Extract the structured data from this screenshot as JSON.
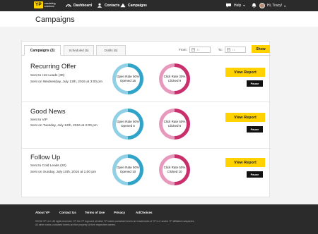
{
  "nav": {
    "logo_mark": "YP",
    "logo_text_1": "marketing",
    "logo_text_2": "solutions",
    "items": [
      {
        "label": "Dashboard",
        "icon": "dashboard-icon"
      },
      {
        "label": "Contacts",
        "icon": "contacts-icon"
      },
      {
        "label": "Campaigns",
        "icon": "campaigns-icon"
      }
    ],
    "help_label": "Help",
    "user_label": "Hi, Tracy!"
  },
  "page": {
    "title": "Campaigns"
  },
  "tabs": [
    {
      "label": "Campaigns (3)",
      "active": true
    },
    {
      "label": "Scheduled (5)",
      "active": false
    },
    {
      "label": "Drafts (6)",
      "active": false
    }
  ],
  "filter": {
    "from_label": "From:",
    "to_label": "To:",
    "from_value": "/ /",
    "to_value": "/ /",
    "show_label": "Show"
  },
  "campaigns": [
    {
      "title": "Recurring Offer",
      "sent_to": "Sent to Hot Leads (30)",
      "sent_on": "Sent on Wednesday, July 13th, 2016 at 3:00 pm",
      "open_rate": "Open Rate 50%",
      "opened": "Opened 15",
      "click_rate": "Click Rate 30%",
      "clicked": "Clicked 9",
      "open_fraction": 0.5,
      "click_fraction": 0.5,
      "view_label": "View Report",
      "pause_label": "Pause"
    },
    {
      "title": "Good News",
      "sent_to": "Sent to VIP",
      "sent_on": "Sent on Tuesday, July 12th, 2016 at 2:00 pm",
      "open_rate": "Open Rate 50%",
      "opened": "Opened 5",
      "click_rate": "Click Rate 50%",
      "clicked": "Clicked 6",
      "open_fraction": 0.5,
      "click_fraction": 0.5,
      "view_label": "View Report",
      "pause_label": "Pause"
    },
    {
      "title": "Follow Up",
      "sent_to": "Sent to Cold Leads (20)",
      "sent_on": "Sent on Sunday, July 10th, 2016 at 1:00 pm",
      "open_rate": "Open Rate 50%",
      "opened": "Opened 10",
      "click_rate": "Click Rate 50%",
      "clicked": "Clicked 10",
      "open_fraction": 0.5,
      "click_fraction": 0.5,
      "view_label": "View Report",
      "pause_label": "Pause"
    }
  ],
  "footer": {
    "links": [
      "About YP",
      "Contact Us",
      "Terms of Use",
      "Privacy",
      "AdChoices"
    ],
    "legal_1": "©2016 YP LLC. All rights reserved. YP, the YP logo and all other YP marks contained herein are trademarks of YP LLC and/or YP affiliated companies.",
    "legal_2": "All other marks contained herein are the property of their respective owners."
  },
  "colors": {
    "accent": "#ffd200",
    "open_ring": "#2fa3c8",
    "click_ring": "#c92f6b",
    "nav_bg": "#2b2b2b"
  }
}
